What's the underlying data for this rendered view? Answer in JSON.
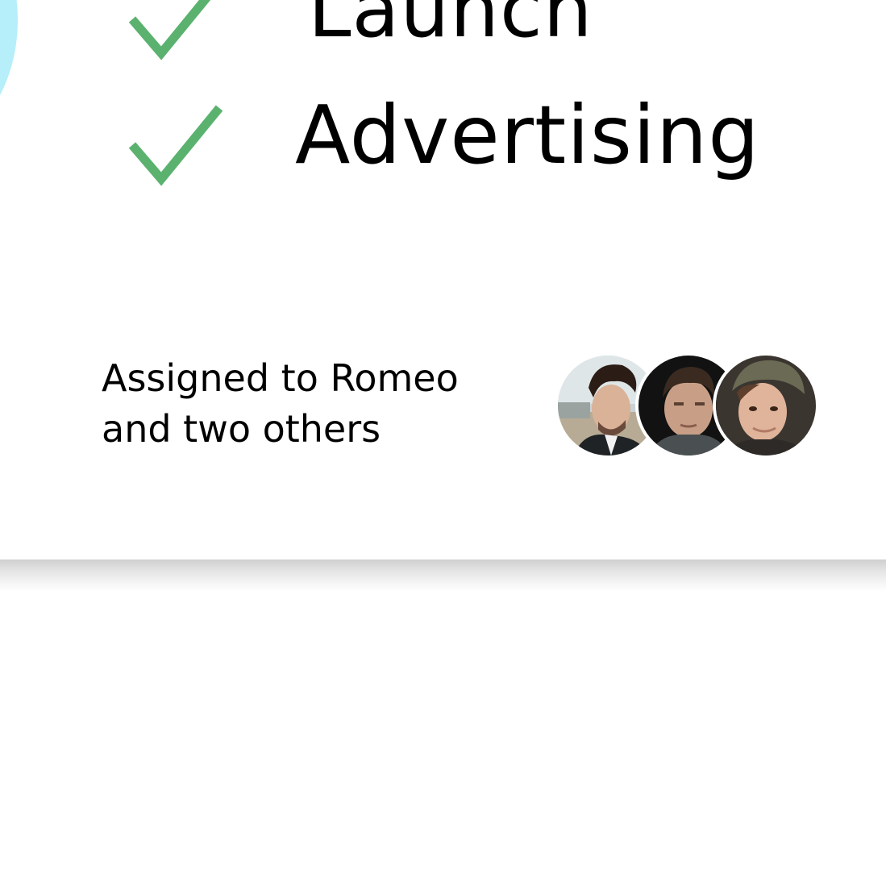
{
  "tasks": [
    {
      "label": "Launch",
      "done": true
    },
    {
      "label": "Advertising",
      "done": true
    }
  ],
  "assignment": {
    "line1": "Assigned to Romeo",
    "line2": "and two others"
  },
  "avatars": [
    {
      "name": "avatar-romeo"
    },
    {
      "name": "avatar-other-1"
    },
    {
      "name": "avatar-other-2"
    }
  ],
  "colors": {
    "check": "#5bb26f",
    "deco_circle": "#b6eef9",
    "text": "#000000"
  },
  "icons": {
    "check": "checkmark-icon"
  }
}
